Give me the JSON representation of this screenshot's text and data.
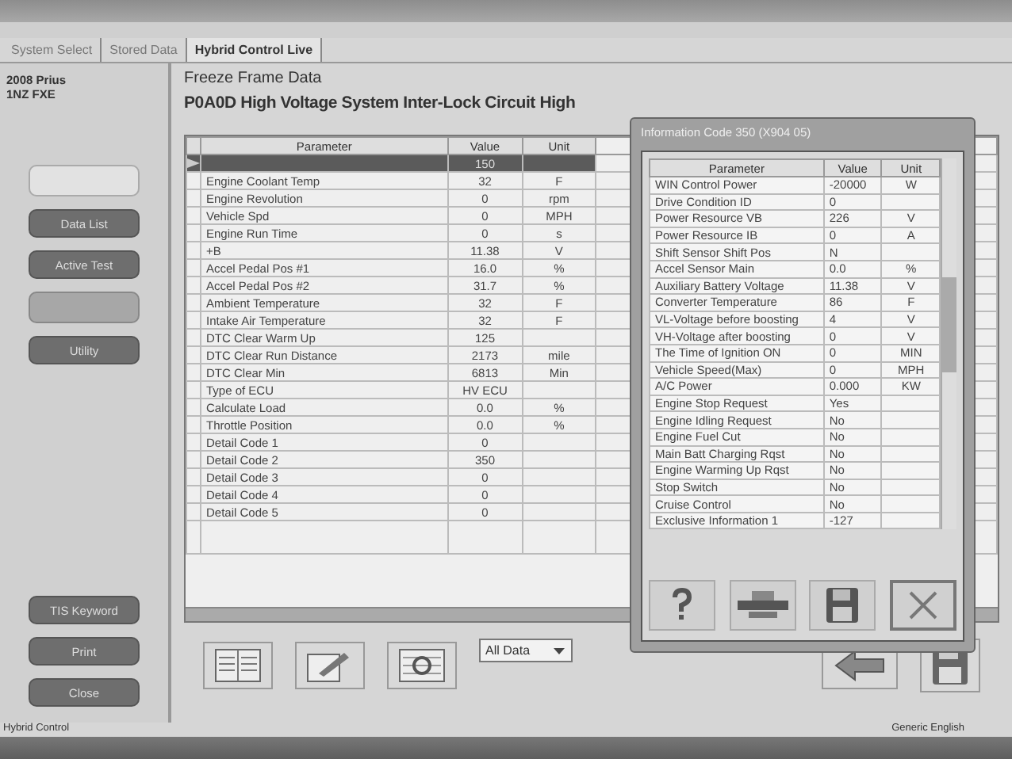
{
  "tabs": [
    {
      "label": "System Select",
      "selected": false
    },
    {
      "label": "Stored Data",
      "selected": false
    },
    {
      "label": "Hybrid Control Live",
      "selected": true
    }
  ],
  "vehicle": {
    "model": "2008 Prius",
    "engine": "1NZ FXE"
  },
  "sidebar_buttons": [
    {
      "label": "Data List",
      "disabled": false
    },
    {
      "label": "Active Test",
      "disabled": false
    },
    {
      "label": "Utility",
      "disabled": false
    }
  ],
  "sidebar_bottom_buttons": [
    {
      "label": "TIS Keyword"
    },
    {
      "label": "Print"
    },
    {
      "label": "Close"
    }
  ],
  "heading": "Freeze Frame Data",
  "dtc": "P0A0D High Voltage System Inter-Lock Circuit High",
  "table": {
    "columns": [
      "Parameter",
      "Value",
      "Unit"
    ],
    "rows": [
      {
        "value": "150",
        "unit": "",
        "selected": true
      },
      {
        "parameter": "Engine Coolant Temp",
        "value": "32",
        "unit": "F",
        "selected": false
      },
      {
        "parameter": "Engine Revolution",
        "value": "0",
        "unit": "rpm",
        "selected": false
      },
      {
        "parameter": "Vehicle Spd",
        "value": "0",
        "unit": "MPH",
        "selected": false
      },
      {
        "parameter": "Engine Run Time",
        "value": "0",
        "unit": "s",
        "selected": false
      },
      {
        "parameter": "+B",
        "value": "11.38",
        "unit": "V",
        "selected": false
      },
      {
        "parameter": "Accel Pedal Pos #1",
        "value": "16.0",
        "unit": "%",
        "selected": false
      },
      {
        "parameter": "Accel Pedal Pos #2",
        "value": "31.7",
        "unit": "%",
        "selected": false
      },
      {
        "parameter": "Ambient Temperature",
        "value": "32",
        "unit": "F",
        "selected": false
      },
      {
        "parameter": "Intake Air Temperature",
        "value": "32",
        "unit": "F",
        "selected": false
      },
      {
        "parameter": "DTC Clear Warm Up",
        "value": "125",
        "unit": "",
        "selected": false
      },
      {
        "parameter": "DTC Clear Run Distance",
        "value": "2173",
        "unit": "mile",
        "selected": false
      },
      {
        "parameter": "DTC Clear Min",
        "value": "6813",
        "unit": "Min",
        "selected": false
      },
      {
        "parameter": "Type of ECU",
        "value": "HV ECU",
        "unit": "",
        "selected": false
      },
      {
        "parameter": "Calculate Load",
        "value": "0.0",
        "unit": "%",
        "selected": false
      },
      {
        "parameter": "Throttle Position",
        "value": "0.0",
        "unit": "%",
        "selected": false
      },
      {
        "parameter": "Detail Code 1",
        "value": "0",
        "unit": "",
        "selected": false
      },
      {
        "parameter": "Detail Code 2",
        "value": "350",
        "unit": "",
        "selected": false
      },
      {
        "parameter": "Detail Code 3",
        "value": "0",
        "unit": "",
        "selected": false
      },
      {
        "parameter": "Detail Code 4",
        "value": "0",
        "unit": "",
        "selected": false
      },
      {
        "parameter": "Detail Code 5",
        "value": "0",
        "unit": "",
        "selected": false
      }
    ]
  },
  "dialog": {
    "title": "Information Code 350 (X904 05)",
    "columns": [
      "Parameter",
      "Value",
      "Unit"
    ],
    "rows": [
      {
        "parameter": "WIN Control Power",
        "value": "-20000",
        "unit": "W"
      },
      {
        "parameter": "Drive Condition ID",
        "value": "0",
        "unit": ""
      },
      {
        "parameter": "Power Resource VB",
        "value": "226",
        "unit": "V"
      },
      {
        "parameter": "Power Resource IB",
        "value": "0",
        "unit": "A"
      },
      {
        "parameter": "Shift Sensor Shift Pos",
        "value": "N",
        "unit": ""
      },
      {
        "parameter": "Accel Sensor Main",
        "value": "0.0",
        "unit": "%"
      },
      {
        "parameter": "Auxiliary Battery Voltage",
        "value": "11.38",
        "unit": "V"
      },
      {
        "parameter": "Converter Temperature",
        "value": "86",
        "unit": "F"
      },
      {
        "parameter": "VL-Voltage before boosting",
        "value": "4",
        "unit": "V"
      },
      {
        "parameter": "VH-Voltage after boosting",
        "value": "0",
        "unit": "V"
      },
      {
        "parameter": "The Time of Ignition ON",
        "value": "0",
        "unit": "MIN"
      },
      {
        "parameter": "Vehicle Speed(Max)",
        "value": "0",
        "unit": "MPH"
      },
      {
        "parameter": "A/C Power",
        "value": "0.000",
        "unit": "KW"
      },
      {
        "parameter": "Engine Stop Request",
        "value": "Yes",
        "unit": ""
      },
      {
        "parameter": "Engine Idling Request",
        "value": "No",
        "unit": ""
      },
      {
        "parameter": "Engine Fuel Cut",
        "value": "No",
        "unit": ""
      },
      {
        "parameter": "Main Batt Charging Rqst",
        "value": "No",
        "unit": ""
      },
      {
        "parameter": "Engine Warming Up Rqst",
        "value": "No",
        "unit": ""
      },
      {
        "parameter": "Stop Switch",
        "value": "No",
        "unit": ""
      },
      {
        "parameter": "Cruise Control",
        "value": "No",
        "unit": ""
      },
      {
        "parameter": "Exclusive Information 1",
        "value": "-127",
        "unit": ""
      }
    ]
  },
  "filter": {
    "value": "All Data"
  },
  "status_bar": {
    "left": "Hybrid Control",
    "language": "Generic English"
  }
}
